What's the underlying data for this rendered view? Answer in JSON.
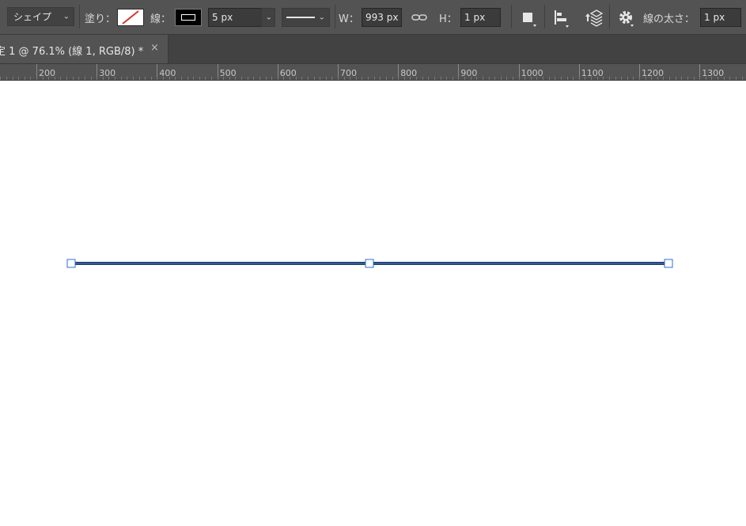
{
  "toolbar": {
    "tool_mode": "シェイプ",
    "fill_label": "塗り：",
    "stroke_label": "線：",
    "stroke_width": "5 px",
    "width_label": "W：",
    "width_value": "993 px",
    "height_label": "H：",
    "height_value": "1 px",
    "line_weight_label": "線の太さ：",
    "line_weight_value": "1 px"
  },
  "document_tab": {
    "title": "定 1 @ 76.1% (線 1, RGB/8) *",
    "close_glyph": "×"
  },
  "ruler": {
    "labels": [
      "200",
      "300",
      "400",
      "500",
      "600",
      "700",
      "800",
      "900",
      "1000",
      "1100",
      "1200",
      "1300"
    ]
  },
  "colors": {
    "path_stroke": "#1f3a6b",
    "anchor_fill": "#ffffff",
    "anchor_stroke": "#2f6fd1",
    "fill_none_slash": "#d9322e"
  },
  "icons": [
    "chevron-down-icon",
    "link-icon",
    "path-operations-icon",
    "path-alignment-icon",
    "path-arrangement-icon",
    "gear-icon",
    "close-icon"
  ]
}
